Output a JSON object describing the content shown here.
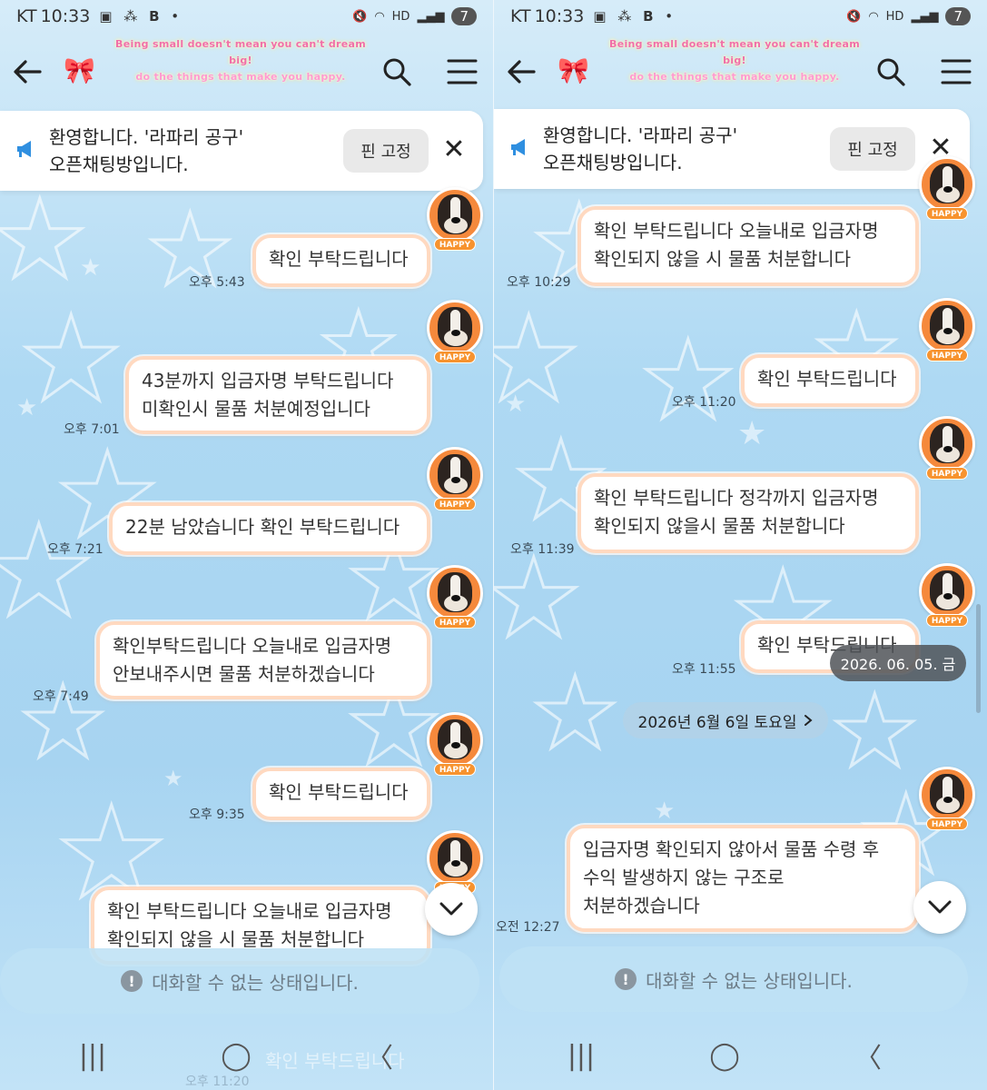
{
  "status_bar": {
    "carrier": "KT",
    "time": "10:33",
    "network": "HD",
    "battery": "7"
  },
  "header": {
    "slogan_line1": "Being small doesn't mean you can't dream big!",
    "slogan_line2": "do the things that make you happy."
  },
  "notice": {
    "line1": "환영합니다. '라파리 공구'",
    "line2": "오픈채팅방입니다.",
    "pin_label": "핀 고정",
    "close_label": "✕"
  },
  "avatar_tag": "HAPPY",
  "left_messages": [
    {
      "text": [
        "확인 부탁드립니다"
      ],
      "time": "오후 5:43"
    },
    {
      "text": [
        "43분까지 입금자명 부탁드립니다",
        "미확인시 물품 처분예정입니다"
      ],
      "time": "오후 7:01"
    },
    {
      "text": [
        "22분 남았습니다 확인 부탁드립니다"
      ],
      "time": "오후 7:21"
    },
    {
      "text": [
        "확인부탁드립니다 오늘내로 입금자명",
        "안보내주시면 물품 처분하겠습니다"
      ],
      "time": "오후 7:49"
    },
    {
      "text": [
        "확인 부탁드립니다"
      ],
      "time": "오후 9:35"
    },
    {
      "text": [
        "확인 부탁드립니다 오늘내로 입금자명",
        "확인되지 않을 시 물품 처분합니다"
      ],
      "time": ""
    }
  ],
  "left_ghost": {
    "text": "확인 부탁드립니다",
    "time": "오후 11:20"
  },
  "right_messages": [
    {
      "text": [
        "확인 부탁드립니다 오늘내로 입금자명",
        "확인되지 않을 시 물품 처분합니다"
      ],
      "time": "오후 10:29"
    },
    {
      "text": [
        "확인 부탁드립니다"
      ],
      "time": "오후 11:20"
    },
    {
      "text": [
        "확인 부탁드립니다 정각까지 입금자명",
        "확인되지 않을시 물품 처분합니다"
      ],
      "time": "오후 11:39"
    },
    {
      "text": [
        "확인 부탁드립니다"
      ],
      "time": "오후 11:55"
    },
    {
      "text": [
        "입금자명 확인되지 않아서 물품 수령 후",
        "수익 발생하지 않는 구조로",
        "처분하겠습니다"
      ],
      "time": "오전 12:27"
    }
  ],
  "date_toast": "2026. 06. 05. 금",
  "date_divider": "2026년 6월 6일 토요일",
  "disabled_notice": "대화할 수 없는 상태입니다.",
  "info_glyph": "!",
  "nav": {
    "recent": "|||",
    "home": "◯",
    "back": "〈"
  },
  "colors": {
    "bubble_border": "#ffd9c0",
    "avatar_bg": "#f5893c",
    "background": "#aed9f3"
  },
  "icons": [
    "back-arrow-icon",
    "bow-icon",
    "search-icon",
    "menu-icon",
    "megaphone-icon",
    "close-icon",
    "chevron-down-icon",
    "info-icon"
  ]
}
